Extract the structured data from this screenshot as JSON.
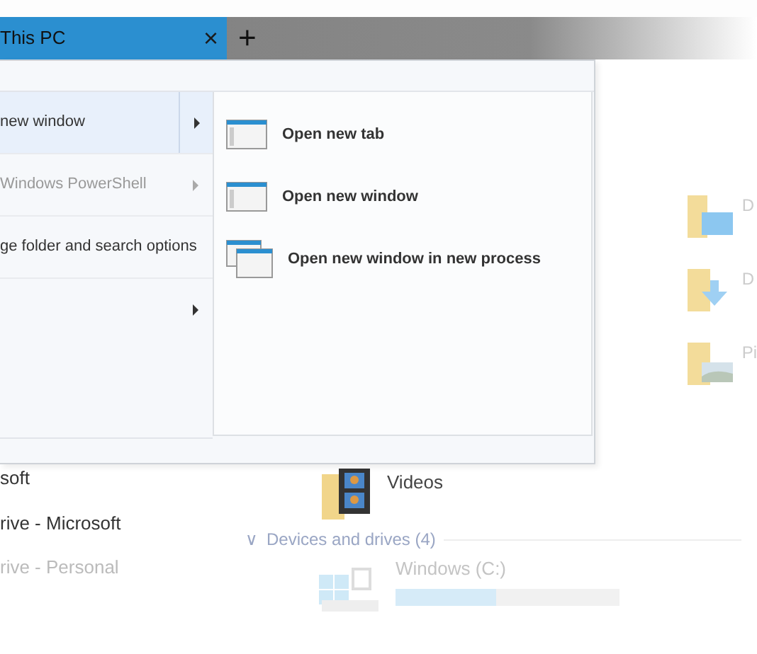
{
  "tabs": [
    {
      "label": "This PC",
      "selected": true,
      "close": "×"
    }
  ],
  "new_tab_button": "+",
  "navigation": [
    {
      "label": "soft",
      "dimmed": false
    },
    {
      "label": "rive - Microsoft",
      "dimmed": false
    },
    {
      "label": "rive - Personal",
      "dimmed": true
    }
  ],
  "folders": [
    {
      "label": "D",
      "kind": "desktop"
    },
    {
      "label": "D",
      "kind": "downloads"
    },
    {
      "label": "Pi",
      "kind": "pictures"
    }
  ],
  "videos_folder": {
    "label": "Videos"
  },
  "devices_section": {
    "header": "Devices and drives (4)",
    "chevron": "∨",
    "drives": [
      {
        "label": "Windows (C:)",
        "level": 0.45
      }
    ]
  },
  "file_menu": {
    "items": [
      {
        "label": "new window",
        "selected": true,
        "disabled": false,
        "submenu": true
      },
      {
        "label": "Windows PowerShell",
        "selected": false,
        "disabled": true,
        "submenu": true
      },
      {
        "label": "ge folder and search options",
        "selected": false,
        "disabled": false,
        "submenu": false
      },
      {
        "selected": false,
        "disabled": false,
        "submenu": true
      }
    ],
    "submenu": [
      {
        "label": "Open new tab",
        "kind": "single"
      },
      {
        "label": "Open new window",
        "kind": "single"
      },
      {
        "label": "Open new window in new process",
        "kind": "double"
      }
    ]
  }
}
